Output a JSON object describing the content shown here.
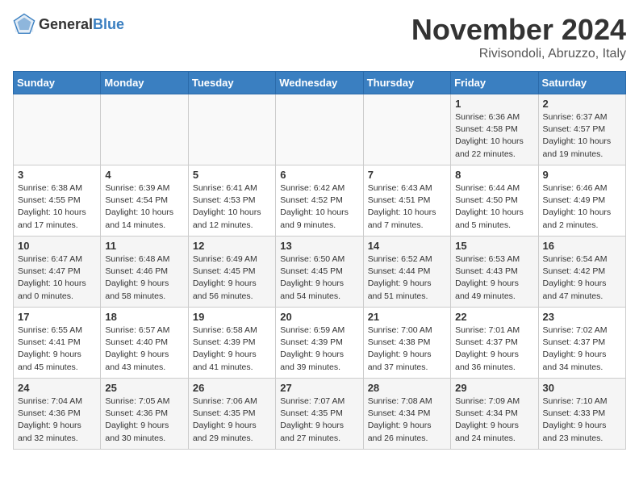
{
  "header": {
    "logo_general": "General",
    "logo_blue": "Blue",
    "month": "November 2024",
    "location": "Rivisondoli, Abruzzo, Italy"
  },
  "weekdays": [
    "Sunday",
    "Monday",
    "Tuesday",
    "Wednesday",
    "Thursday",
    "Friday",
    "Saturday"
  ],
  "weeks": [
    [
      {
        "day": "",
        "info": ""
      },
      {
        "day": "",
        "info": ""
      },
      {
        "day": "",
        "info": ""
      },
      {
        "day": "",
        "info": ""
      },
      {
        "day": "",
        "info": ""
      },
      {
        "day": "1",
        "info": "Sunrise: 6:36 AM\nSunset: 4:58 PM\nDaylight: 10 hours and 22 minutes."
      },
      {
        "day": "2",
        "info": "Sunrise: 6:37 AM\nSunset: 4:57 PM\nDaylight: 10 hours and 19 minutes."
      }
    ],
    [
      {
        "day": "3",
        "info": "Sunrise: 6:38 AM\nSunset: 4:55 PM\nDaylight: 10 hours and 17 minutes."
      },
      {
        "day": "4",
        "info": "Sunrise: 6:39 AM\nSunset: 4:54 PM\nDaylight: 10 hours and 14 minutes."
      },
      {
        "day": "5",
        "info": "Sunrise: 6:41 AM\nSunset: 4:53 PM\nDaylight: 10 hours and 12 minutes."
      },
      {
        "day": "6",
        "info": "Sunrise: 6:42 AM\nSunset: 4:52 PM\nDaylight: 10 hours and 9 minutes."
      },
      {
        "day": "7",
        "info": "Sunrise: 6:43 AM\nSunset: 4:51 PM\nDaylight: 10 hours and 7 minutes."
      },
      {
        "day": "8",
        "info": "Sunrise: 6:44 AM\nSunset: 4:50 PM\nDaylight: 10 hours and 5 minutes."
      },
      {
        "day": "9",
        "info": "Sunrise: 6:46 AM\nSunset: 4:49 PM\nDaylight: 10 hours and 2 minutes."
      }
    ],
    [
      {
        "day": "10",
        "info": "Sunrise: 6:47 AM\nSunset: 4:47 PM\nDaylight: 10 hours and 0 minutes."
      },
      {
        "day": "11",
        "info": "Sunrise: 6:48 AM\nSunset: 4:46 PM\nDaylight: 9 hours and 58 minutes."
      },
      {
        "day": "12",
        "info": "Sunrise: 6:49 AM\nSunset: 4:45 PM\nDaylight: 9 hours and 56 minutes."
      },
      {
        "day": "13",
        "info": "Sunrise: 6:50 AM\nSunset: 4:45 PM\nDaylight: 9 hours and 54 minutes."
      },
      {
        "day": "14",
        "info": "Sunrise: 6:52 AM\nSunset: 4:44 PM\nDaylight: 9 hours and 51 minutes."
      },
      {
        "day": "15",
        "info": "Sunrise: 6:53 AM\nSunset: 4:43 PM\nDaylight: 9 hours and 49 minutes."
      },
      {
        "day": "16",
        "info": "Sunrise: 6:54 AM\nSunset: 4:42 PM\nDaylight: 9 hours and 47 minutes."
      }
    ],
    [
      {
        "day": "17",
        "info": "Sunrise: 6:55 AM\nSunset: 4:41 PM\nDaylight: 9 hours and 45 minutes."
      },
      {
        "day": "18",
        "info": "Sunrise: 6:57 AM\nSunset: 4:40 PM\nDaylight: 9 hours and 43 minutes."
      },
      {
        "day": "19",
        "info": "Sunrise: 6:58 AM\nSunset: 4:39 PM\nDaylight: 9 hours and 41 minutes."
      },
      {
        "day": "20",
        "info": "Sunrise: 6:59 AM\nSunset: 4:39 PM\nDaylight: 9 hours and 39 minutes."
      },
      {
        "day": "21",
        "info": "Sunrise: 7:00 AM\nSunset: 4:38 PM\nDaylight: 9 hours and 37 minutes."
      },
      {
        "day": "22",
        "info": "Sunrise: 7:01 AM\nSunset: 4:37 PM\nDaylight: 9 hours and 36 minutes."
      },
      {
        "day": "23",
        "info": "Sunrise: 7:02 AM\nSunset: 4:37 PM\nDaylight: 9 hours and 34 minutes."
      }
    ],
    [
      {
        "day": "24",
        "info": "Sunrise: 7:04 AM\nSunset: 4:36 PM\nDaylight: 9 hours and 32 minutes."
      },
      {
        "day": "25",
        "info": "Sunrise: 7:05 AM\nSunset: 4:36 PM\nDaylight: 9 hours and 30 minutes."
      },
      {
        "day": "26",
        "info": "Sunrise: 7:06 AM\nSunset: 4:35 PM\nDaylight: 9 hours and 29 minutes."
      },
      {
        "day": "27",
        "info": "Sunrise: 7:07 AM\nSunset: 4:35 PM\nDaylight: 9 hours and 27 minutes."
      },
      {
        "day": "28",
        "info": "Sunrise: 7:08 AM\nSunset: 4:34 PM\nDaylight: 9 hours and 26 minutes."
      },
      {
        "day": "29",
        "info": "Sunrise: 7:09 AM\nSunset: 4:34 PM\nDaylight: 9 hours and 24 minutes."
      },
      {
        "day": "30",
        "info": "Sunrise: 7:10 AM\nSunset: 4:33 PM\nDaylight: 9 hours and 23 minutes."
      }
    ]
  ]
}
